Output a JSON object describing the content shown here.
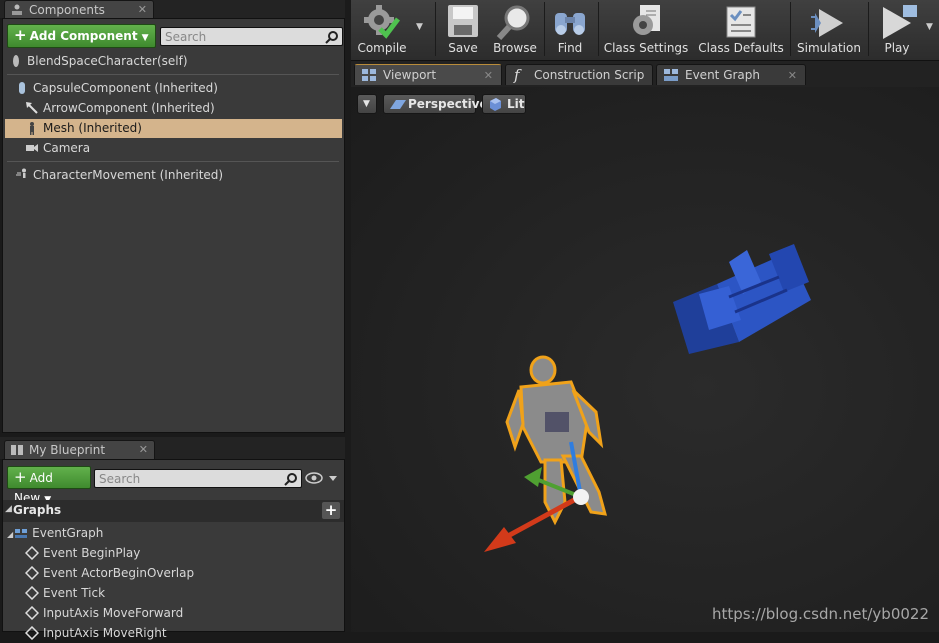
{
  "components_panel": {
    "tab_label": "Components",
    "add_button": "Add Component",
    "search_placeholder": "Search",
    "items": [
      {
        "label": "BlendSpaceCharacter(self)"
      },
      {
        "label": "CapsuleComponent (Inherited)"
      },
      {
        "label": "ArrowComponent (Inherited)"
      },
      {
        "label": "Mesh (Inherited)"
      },
      {
        "label": "Camera"
      },
      {
        "label": "CharacterMovement (Inherited)"
      }
    ]
  },
  "blueprint_panel": {
    "tab_label": "My Blueprint",
    "add_button": "Add New",
    "search_placeholder": "Search",
    "section_label": "Graphs",
    "items": [
      {
        "label": "EventGraph"
      },
      {
        "label": "Event BeginPlay"
      },
      {
        "label": "Event ActorBeginOverlap"
      },
      {
        "label": "Event Tick"
      },
      {
        "label": "InputAxis MoveForward"
      },
      {
        "label": "InputAxis MoveRight"
      }
    ]
  },
  "toolbar": {
    "buttons": [
      {
        "label": "Compile"
      },
      {
        "label": "Save"
      },
      {
        "label": "Browse"
      },
      {
        "label": "Find"
      },
      {
        "label": "Class Settings"
      },
      {
        "label": "Class Defaults"
      },
      {
        "label": "Simulation"
      },
      {
        "label": "Play"
      }
    ]
  },
  "doc_tabs": [
    {
      "label": "Viewport"
    },
    {
      "label": "Construction Scrip"
    },
    {
      "label": "Event Graph"
    }
  ],
  "viewport": {
    "perspective_label": "Perspective",
    "lit_label": "Lit",
    "watermark": "https://blog.csdn.net/yb0022"
  },
  "colors": {
    "accent_green": "#4f9e3a",
    "selection": "#d4b48c",
    "active_tab_border": "#b98c3a"
  }
}
